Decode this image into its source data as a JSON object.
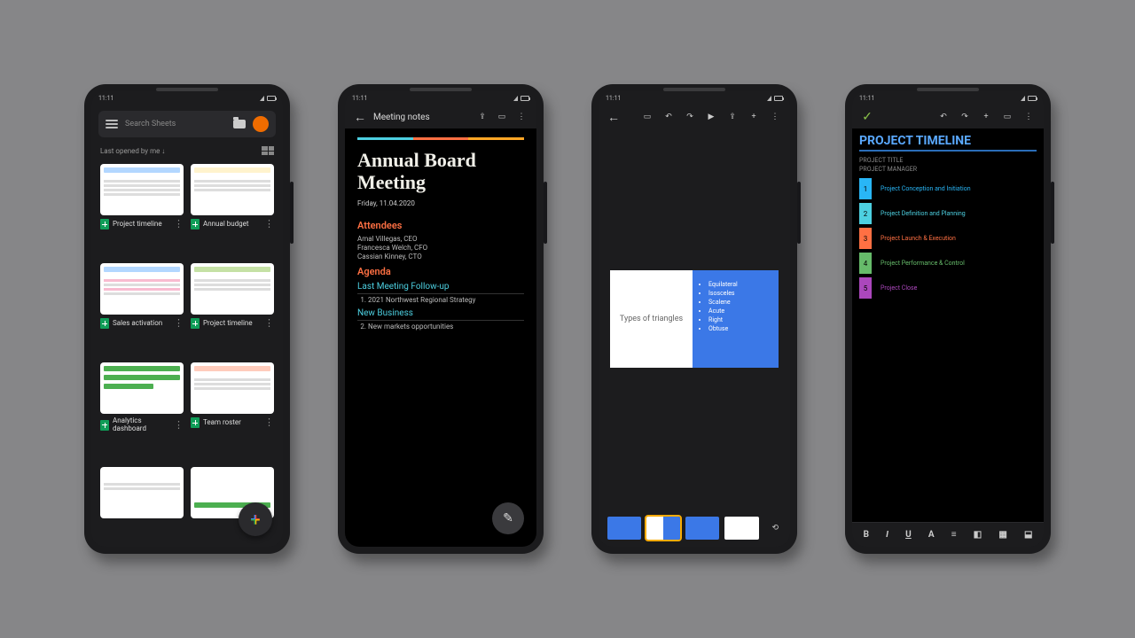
{
  "status_time": "11:11",
  "sheets_list": {
    "search_placeholder": "Search Sheets",
    "filter_label": "Last opened by me ↓",
    "tiles": [
      {
        "title": "Project timeline"
      },
      {
        "title": "Annual budget"
      },
      {
        "title": "Sales activation"
      },
      {
        "title": "Project timeline"
      },
      {
        "title": "Analytics dashboard"
      },
      {
        "title": "Team roster"
      }
    ]
  },
  "docs": {
    "doc_title": "Meeting notes",
    "heading": "Annual Board Meeting",
    "date": "Friday, 11.04.2020",
    "section_attendees": "Attendees",
    "attendees": [
      "Amal Villegas, CEO",
      "Francesca Welch, CFO",
      "Cassian Kinney, CTO"
    ],
    "section_agenda": "Agenda",
    "sub_last": "Last Meeting Follow-up",
    "agenda_item_1": "2021 Northwest Regional Strategy",
    "sub_new": "New Business",
    "agenda_item_2": "New markets opportunities"
  },
  "slides": {
    "main_slide_title": "Types of triangles",
    "bullets": [
      "Equilateral",
      "Isosceles",
      "Scalene",
      "Acute",
      "Right",
      "Obtuse"
    ]
  },
  "sheets_editor": {
    "title": "PROJECT TIMELINE",
    "meta_labels": [
      "PROJECT TITLE",
      "PROJECT MANAGER"
    ],
    "phases": [
      {
        "num": "1",
        "label": "Project Conception and Initiation",
        "color": "#29b6f6"
      },
      {
        "num": "2",
        "label": "Project Definition and Planning",
        "color": "#4dd0e1"
      },
      {
        "num": "3",
        "label": "Project Launch & Execution",
        "color": "#ff7043"
      },
      {
        "num": "4",
        "label": "Project Performance & Control",
        "color": "#66bb6a"
      },
      {
        "num": "5",
        "label": "Project Close",
        "color": "#ab47bc"
      }
    ],
    "bottom_labels": [
      "B",
      "I",
      "U",
      "A"
    ]
  }
}
